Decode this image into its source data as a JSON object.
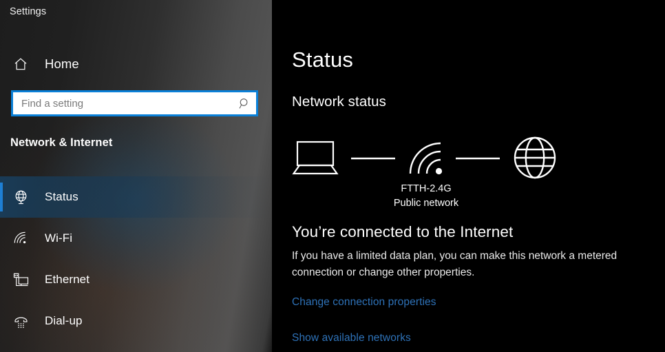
{
  "app": {
    "title": "Settings"
  },
  "sidebar": {
    "home": {
      "label": "Home",
      "icon": "home-icon"
    },
    "search": {
      "placeholder": "Find a setting",
      "value": "",
      "icon": "search-icon"
    },
    "section_title": "Network & Internet",
    "items": [
      {
        "label": "Status",
        "icon": "globe-status-icon",
        "selected": true
      },
      {
        "label": "Wi-Fi",
        "icon": "wifi-icon",
        "selected": false
      },
      {
        "label": "Ethernet",
        "icon": "ethernet-icon",
        "selected": false
      },
      {
        "label": "Dial-up",
        "icon": "dialup-icon",
        "selected": false
      }
    ]
  },
  "main": {
    "page_title": "Status",
    "section_heading": "Network status",
    "diagram": {
      "device_icon": "laptop-icon",
      "link_icon": "connection-line",
      "signal_icon": "wifi-signal-icon",
      "internet_icon": "globe-icon",
      "network_name": "FTTH-2.4G",
      "network_type": "Public network"
    },
    "status_headline": "You’re connected to the Internet",
    "status_description": "If you have a limited data plan, you can make this network a metered connection or change other properties.",
    "links": [
      {
        "label": "Change connection properties"
      },
      {
        "label": "Show available networks"
      }
    ]
  },
  "colors": {
    "accent": "#1e7fd4",
    "link": "#2e72b8",
    "search_focus_border": "#0a80d8",
    "content_background": "#000000"
  }
}
